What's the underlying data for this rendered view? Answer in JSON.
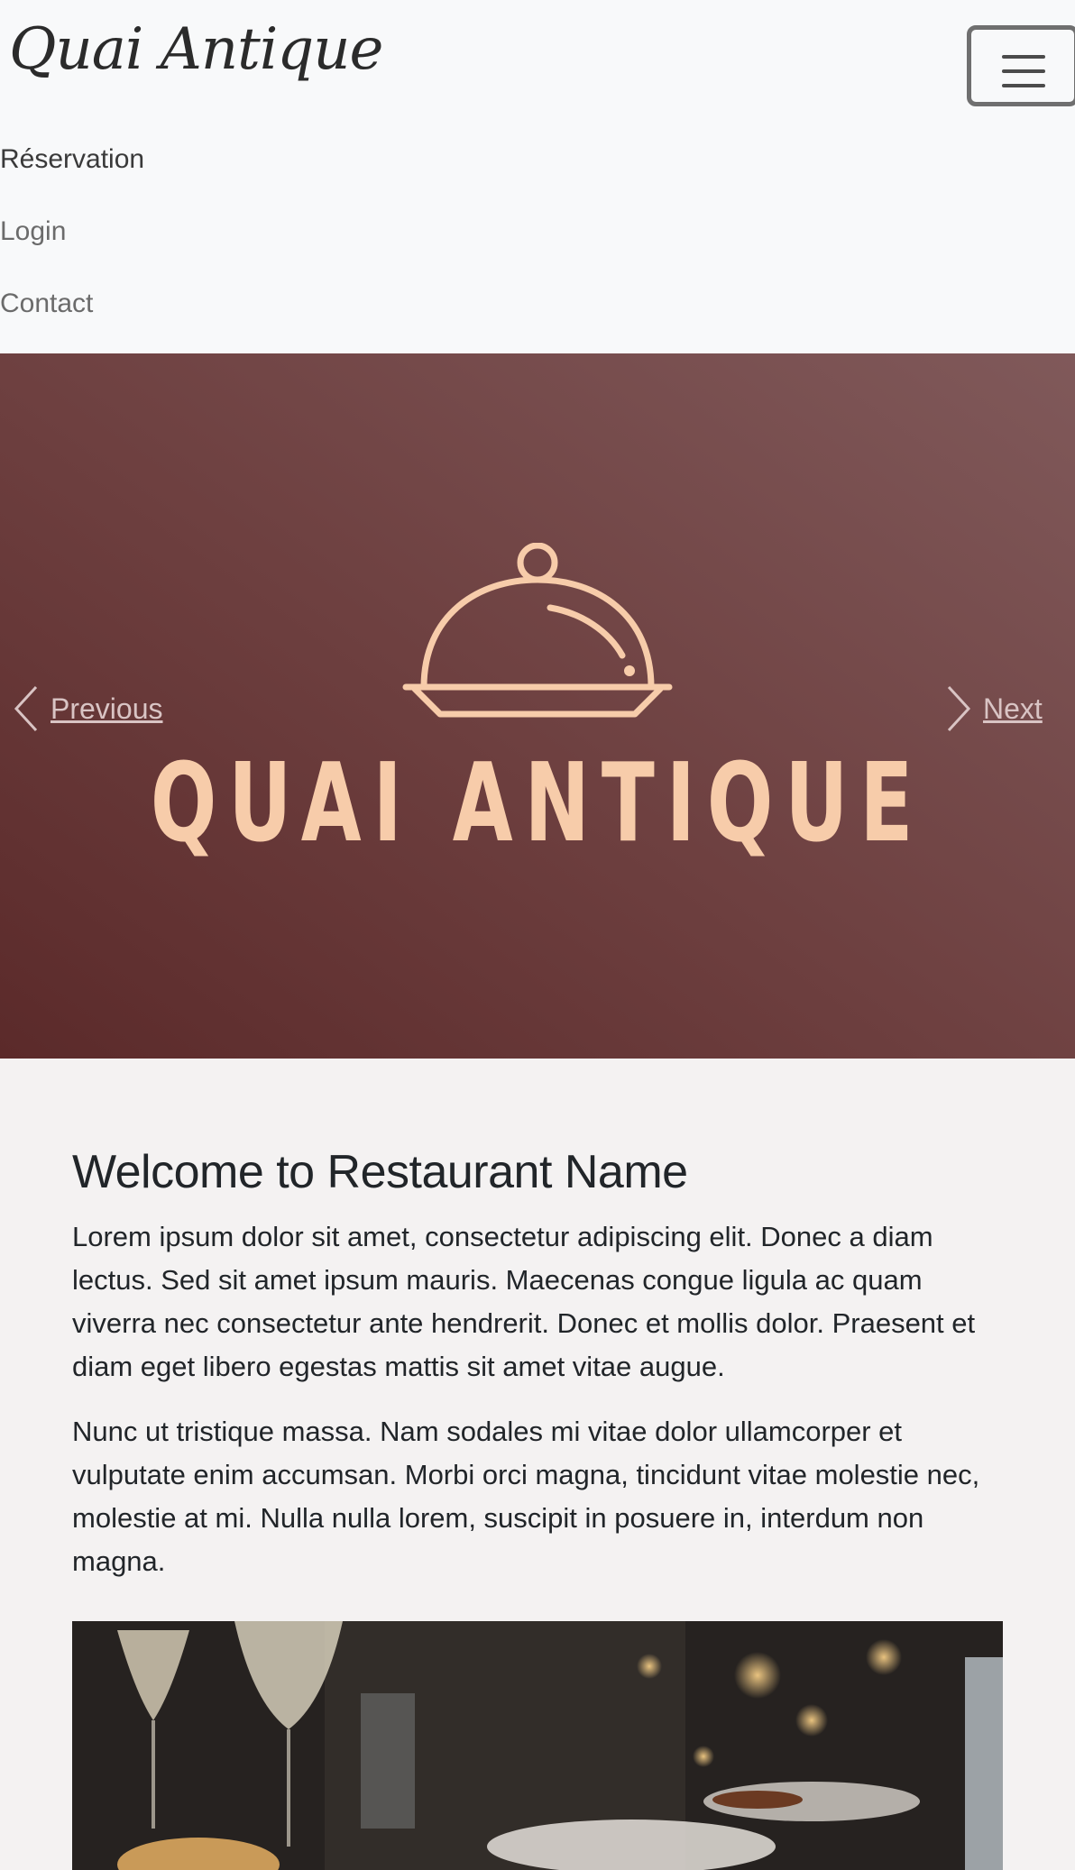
{
  "navbar": {
    "brand": "Quai Antique",
    "links": [
      "Réservation",
      "Login",
      "Contact"
    ],
    "toggler_icon": "hamburger-menu-icon"
  },
  "carousel": {
    "logo_text": "QUAI ANTIQUE",
    "logo_icon": "cloche-icon",
    "prev_label": "Previous",
    "next_label": "Next",
    "prev_icon": "chevron-left-icon",
    "next_icon": "chevron-right-icon",
    "colors": {
      "logo": "#f7ccaa",
      "background": "#6d3f3f"
    }
  },
  "content": {
    "title": "Welcome to Restaurant Name",
    "paragraph1": "Lorem ipsum dolor sit amet, consectetur adipiscing elit. Donec a diam lectus. Sed sit amet ipsum mauris. Maecenas congue ligula ac quam viverra nec consectetur ante hendrerit. Donec et mollis dolor. Praesent et diam eget libero egestas mattis sit amet vitae augue.",
    "paragraph2": "Nunc ut tristique massa. Nam sodales mi vitae dolor ullamcorper et vulputate enim accumsan. Morbi orci magna, tincidunt vitae molestie nec, molestie at mi. Nulla nulla lorem, suscipit in posuere in, interdum non magna."
  }
}
